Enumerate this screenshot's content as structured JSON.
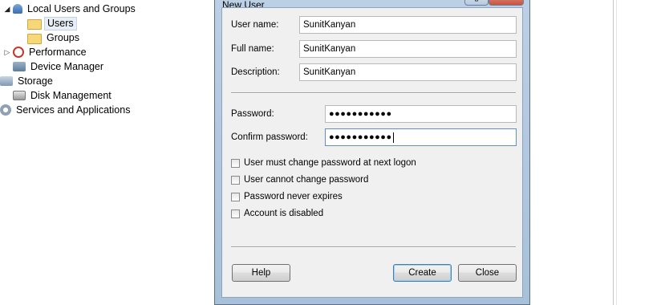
{
  "tree": {
    "items": [
      {
        "label": "Local Users and Groups",
        "icon": "users-icon",
        "expander": "open"
      },
      {
        "label": "Users",
        "icon": "folder-icon",
        "selected": true
      },
      {
        "label": "Groups",
        "icon": "folder-icon"
      },
      {
        "label": "Performance",
        "icon": "performance-icon",
        "expander": "closed"
      },
      {
        "label": "Device Manager",
        "icon": "device-manager-icon"
      },
      {
        "label": "Storage",
        "icon": "storage-icon"
      },
      {
        "label": "Disk Management",
        "icon": "disk-icon"
      },
      {
        "label": "Services and Applications",
        "icon": "services-icon"
      }
    ]
  },
  "dialog": {
    "title": "New User",
    "close_glyph": "✕",
    "restore_glyph": "▯",
    "fields": {
      "user_name": {
        "label": "User name:",
        "value": "SunitKanyan"
      },
      "full_name": {
        "label": "Full name:",
        "value": "SunitKanyan"
      },
      "description": {
        "label": "Description:",
        "value": "SunitKanyan"
      },
      "password": {
        "label": "Password:",
        "value": "●●●●●●●●●●●"
      },
      "confirm_password": {
        "label": "Confirm password:",
        "value": "●●●●●●●●●●●"
      }
    },
    "checkboxes": [
      {
        "label": "User must change password at next logon",
        "checked": false
      },
      {
        "label": "User cannot change password",
        "checked": false
      },
      {
        "label": "Password never expires",
        "checked": false
      },
      {
        "label": "Account is disabled",
        "checked": false
      }
    ],
    "buttons": {
      "help": "Help",
      "create": "Create",
      "close": "Close"
    }
  },
  "colors": {
    "accent": "#3c7fb1",
    "title_bar": "#bcd0e6"
  }
}
